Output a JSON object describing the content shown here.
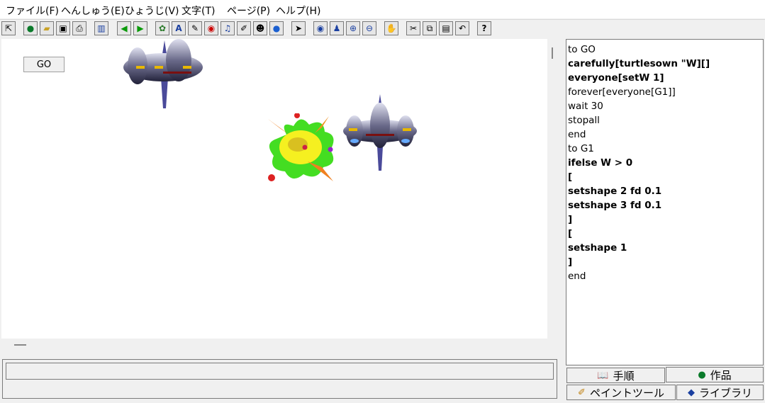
{
  "menu": [
    "ファイル(F)",
    "へんしゅう(E)",
    "ひょうじ(V)",
    "文字(T)",
    "ページ(P)",
    "ヘルプ(H)"
  ],
  "toolbar_icons": [
    "arrow-cursor-icon",
    "globe-icon",
    "open-folder-icon",
    "save-disk-icon",
    "print-icon",
    "layout-icon",
    "back-arrow-icon",
    "forward-arrow-icon",
    "turtle-icon",
    "text-box-icon",
    "pen-icon",
    "eye-shape-icon",
    "music-note-icon",
    "paintbrush-icon",
    "people-icon",
    "sphere-icon",
    "select-pointer-icon",
    "eye-icon",
    "stamp-icon",
    "zoom-in-icon",
    "zoom-out-icon",
    "hand-stop-icon",
    "scissors-icon",
    "copy-icon",
    "paste-icon",
    "undo-icon",
    "help-icon"
  ],
  "canvas": {
    "go_button": "GO"
  },
  "procedures": {
    "lines": [
      {
        "text": "to GO",
        "bold": false
      },
      {
        "text": "carefully[turtlesown \"W][]",
        "bold": true
      },
      {
        "text": "everyone[setW 1]",
        "bold": true
      },
      {
        "text": "forever[everyone[G1]]",
        "bold": false
      },
      {
        "text": "wait 30",
        "bold": false
      },
      {
        "text": "stopall",
        "bold": false
      },
      {
        "text": "end",
        "bold": false
      },
      {
        "text": "to G1",
        "bold": false
      },
      {
        "text": "ifelse W > 0",
        "bold": true
      },
      {
        "text": "[",
        "bold": true
      },
      {
        "text": "setshape 2 fd 0.1",
        "bold": true
      },
      {
        "text": "setshape 3 fd 0.1",
        "bold": true
      },
      {
        "text": "]",
        "bold": true
      },
      {
        "text": "[",
        "bold": true
      },
      {
        "text": "setshape 1",
        "bold": true
      },
      {
        "text": "]",
        "bold": true
      },
      {
        "text": "end",
        "bold": false
      }
    ]
  },
  "tabs": {
    "procedures": "手順",
    "projects": "作品",
    "paint_tools": "ペイントツール",
    "library": "ライブラリ"
  }
}
